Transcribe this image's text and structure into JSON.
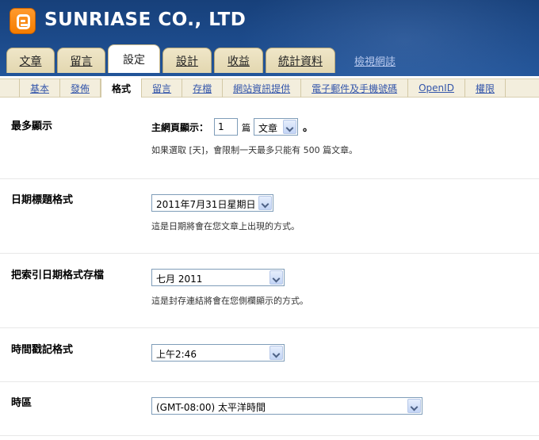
{
  "header": {
    "brand": "SUNRIASE CO., LTD",
    "logo_icon": "blogger-logo-icon"
  },
  "tabs": [
    {
      "label": "文章",
      "active": false
    },
    {
      "label": "留言",
      "active": false
    },
    {
      "label": "設定",
      "active": true
    },
    {
      "label": "設計",
      "active": false
    },
    {
      "label": "收益",
      "active": false
    },
    {
      "label": "統計資料",
      "active": false
    }
  ],
  "view_blog": "檢視網誌",
  "subnav": [
    {
      "label": "基本",
      "active": false
    },
    {
      "label": "發佈",
      "active": false
    },
    {
      "label": "格式",
      "active": true
    },
    {
      "label": "留言",
      "active": false
    },
    {
      "label": "存檔",
      "active": false
    },
    {
      "label": "網站資訊提供",
      "active": false
    },
    {
      "label": "電子郵件及手機號碼",
      "active": false
    },
    {
      "label": "OpenID",
      "active": false
    },
    {
      "label": "權限",
      "active": false
    }
  ],
  "settings": {
    "max_display": {
      "label": "最多顯示",
      "prefix": "主網頁顯示：",
      "count": "1",
      "unit": "篇",
      "type_value": "文章",
      "suffix": "。",
      "help": "如果選取 [天]，會限制一天最多只能有 500 篇文章。"
    },
    "date_header": {
      "label": "日期標題格式",
      "value": "2011年7月31日星期日",
      "help": "這是日期將會在您文章上出現的方式。"
    },
    "archive_date": {
      "label": "把索引日期格式存檔",
      "value": "七月 2011",
      "help": "這是封存連結將會在您側欄顯示的方式。"
    },
    "timestamp": {
      "label": "時間戳記格式",
      "value": "上午2:46"
    },
    "timezone": {
      "label": "時區",
      "value": "(GMT-08:00) 太平洋時間"
    }
  }
}
